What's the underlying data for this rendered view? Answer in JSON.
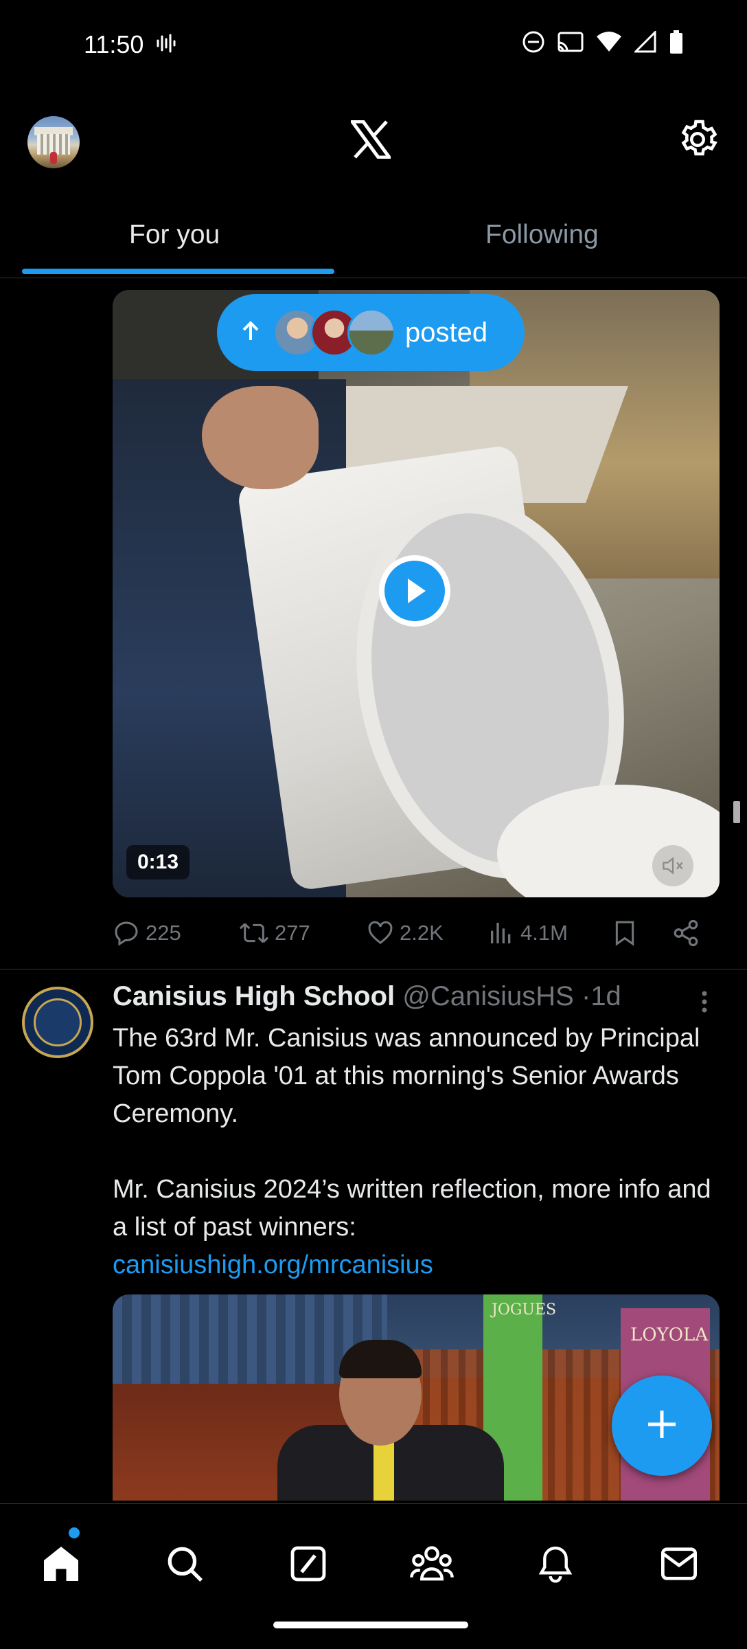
{
  "status_bar": {
    "time": "11:50",
    "icons": [
      "sound-wave-icon",
      "do-not-disturb-icon",
      "cast-icon",
      "wifi-icon",
      "signal-icon",
      "battery-icon"
    ]
  },
  "top_bar": {
    "logo": "X",
    "icons": [
      "profile-avatar",
      "x-logo-icon",
      "settings-icon"
    ]
  },
  "tabs": [
    {
      "label": "For you",
      "selected": true
    },
    {
      "label": "Following",
      "selected": false
    }
  ],
  "posted_pill": {
    "label": "posted",
    "icon": "arrow-up-icon"
  },
  "tweet1": {
    "media": {
      "type": "video",
      "duration": "0:13",
      "icons": [
        "play-icon",
        "mute-icon"
      ]
    },
    "actions": {
      "replies": "225",
      "retweets": "277",
      "likes": "2.2K",
      "views": "4.1M"
    }
  },
  "tweet2": {
    "display_name": "Canisius High School",
    "handle": "@CanisiusHS",
    "separator": "·",
    "time": "1d",
    "body_paragraph1": "The 63rd Mr. Canisius was announced by Principal Tom Coppola '01 at this morning's Senior Awards Ceremony.",
    "body_paragraph2": "Mr. Canisius 2024’s written reflection, more info and a list of past winners:",
    "link": "canisiushigh.org/mrcanisius",
    "media": {
      "banner_left": "JOGUES",
      "banner_right": "LOYOLA"
    }
  },
  "fab": {
    "icon": "plus-icon"
  },
  "bottom_nav": {
    "items": [
      "home-icon",
      "search-icon",
      "grok-icon",
      "communities-icon",
      "notifications-icon",
      "messages-icon"
    ],
    "home_has_badge": true
  },
  "colors": {
    "accent": "#1d9bf0",
    "background": "#000000",
    "text_primary": "#e7e9ea",
    "text_secondary": "#71767b"
  }
}
